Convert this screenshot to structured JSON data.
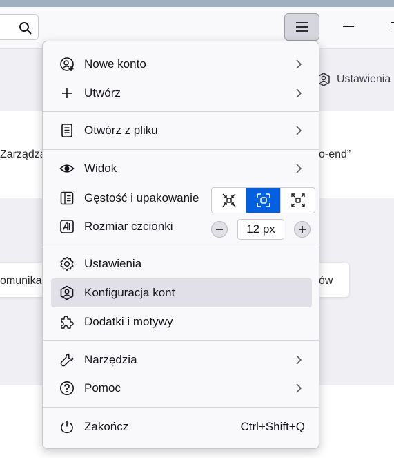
{
  "background": {
    "settings_tab_label": "Ustawienia",
    "row_text_left": "Zarządza",
    "row_text_right": "o-end”",
    "card_text_left": "omunika",
    "card_text_right": "ów"
  },
  "menu": {
    "items": [
      {
        "id": "new-account",
        "label": "Nowe konto",
        "icon": "new-account-icon",
        "submenu": true
      },
      {
        "id": "create",
        "label": "Utwórz",
        "icon": "plus-icon",
        "submenu": true
      },
      {
        "id": "open-file",
        "label": "Otwórz z pliku",
        "icon": "file-icon",
        "submenu": true
      },
      {
        "id": "view",
        "label": "Widok",
        "icon": "eye-icon",
        "submenu": true
      },
      {
        "id": "density",
        "label": "Gęstość i upakowanie",
        "icon": "density-icon"
      },
      {
        "id": "font-size",
        "label": "Rozmiar czcionki",
        "icon": "font-size-icon"
      },
      {
        "id": "settings",
        "label": "Ustawienia",
        "icon": "gear-icon"
      },
      {
        "id": "account-settings",
        "label": "Konfiguracja kont",
        "icon": "account-shield-icon"
      },
      {
        "id": "addons",
        "label": "Dodatki i motywy",
        "icon": "puzzle-icon"
      },
      {
        "id": "tools",
        "label": "Narzędzia",
        "icon": "wrench-icon",
        "submenu": true
      },
      {
        "id": "help",
        "label": "Pomoc",
        "icon": "help-icon",
        "submenu": true
      },
      {
        "id": "quit",
        "label": "Zakończ",
        "icon": "power-icon",
        "shortcut": "Ctrl+Shift+Q"
      }
    ],
    "density_options": [
      "compact",
      "normal",
      "relaxed"
    ],
    "density_selected": "normal",
    "font_size_value": "12 px",
    "accent_color": "#0060df",
    "hover_item": "account-settings"
  }
}
